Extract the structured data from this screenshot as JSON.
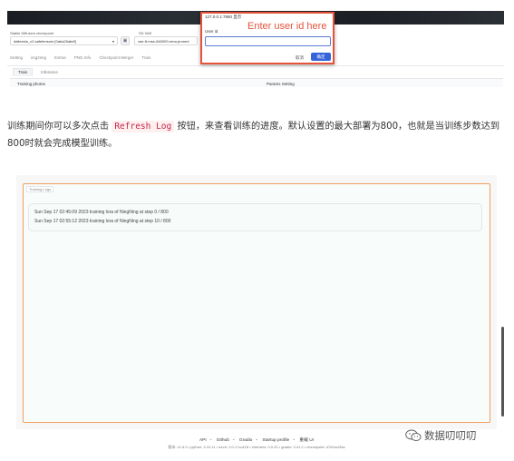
{
  "webui": {
    "checkpoint_label": "Stable Diffusion checkpoint",
    "checkpoint_value": "dalleestu_v2.safetensors [0aba26abdf]",
    "refresh_icon": "refresh-icon",
    "sd_vae_label": "SD VAE",
    "sd_vae_value": "vae-ft-mse-840000-ema-pruned",
    "tabs": [
      "Setting",
      "img2img",
      "Extras",
      "PNG Info",
      "Checkpoint Merger",
      "Train"
    ],
    "subtabs": [
      "Train",
      "Inference"
    ],
    "panel_left": "Training photos",
    "panel_right": "Params Setting"
  },
  "dialog": {
    "origin": "127.0.0.1:7860 显示",
    "headline": "Enter user id here",
    "field_label": "User id",
    "field_value": "",
    "cancel_label": "取消",
    "ok_label": "确定",
    "border_color": "#e5533b"
  },
  "paragraph": {
    "before": "训练期间你可以多次点击",
    "code": "Refresh Log",
    "after": "按钮，来查看训练的进度。默认设置的最大部署为800，也就是当训练步数达到800时就会完成模型训练。"
  },
  "training_logs": {
    "title": "Training Logs",
    "lines": [
      "Sun Sep 17 02:45:09 2023 training lora of NingNing at step 0 / 800",
      "Sun Sep 17 02:55:12 2023 training lora of NingNing at step 10 / 800"
    ]
  },
  "footer": {
    "links": [
      "API",
      "Github",
      "Gradio",
      "Startup profile",
      "重载 UI"
    ],
    "version": "版本: v1.6.0  •  python: 3.10.11  •  torch: 2.0.1+cu118  •  xformers: 0.0.20  •  gradio: 3.41.2  •  checkpoint: d7e2ac2f4a"
  },
  "watermark": {
    "account_name": "数据叨叨叨",
    "icon": "wechat-icon"
  }
}
